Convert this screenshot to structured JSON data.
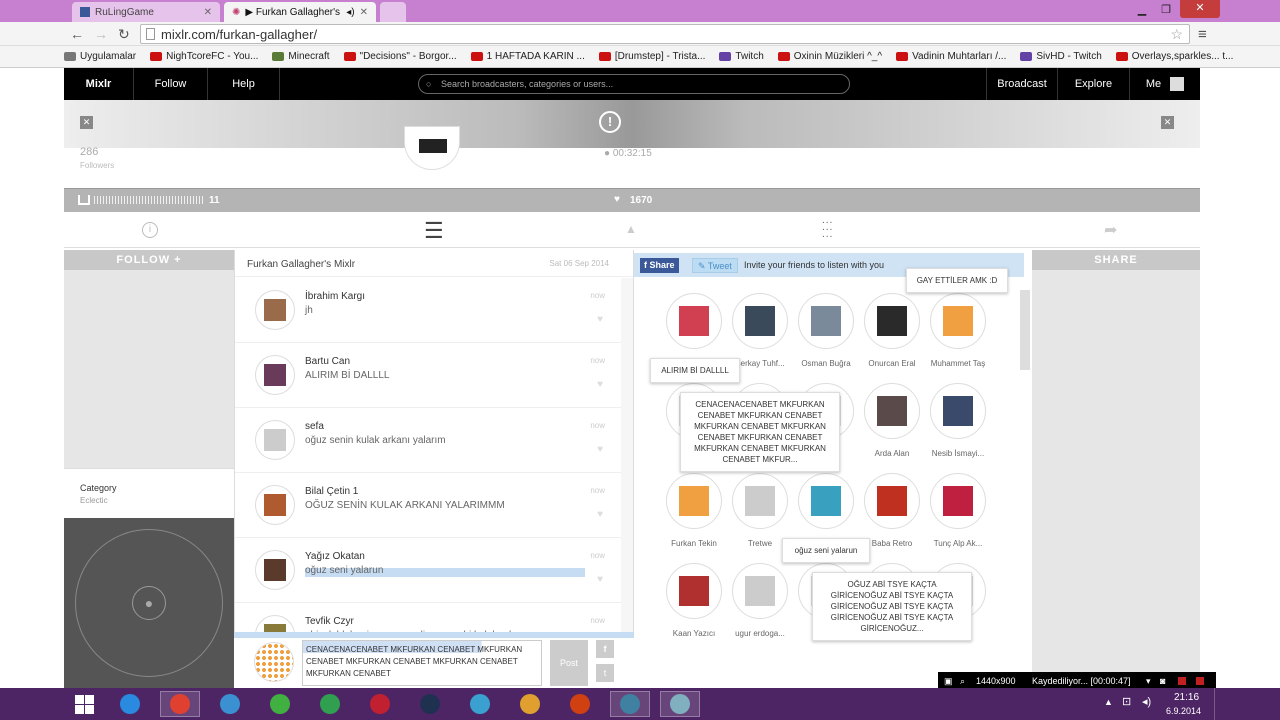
{
  "browser": {
    "tabs": [
      {
        "label": "RuLingGame"
      },
      {
        "label": "▶ Furkan Gallagher's M"
      }
    ],
    "url": "mixlr.com/furkan-gallagher/",
    "bookmarks": [
      {
        "label": "Uygulamalar",
        "color": "#777777"
      },
      {
        "label": "NighTcoreFC - You...",
        "color": "#cc1111"
      },
      {
        "label": "Minecraft",
        "color": "#5a7a3a"
      },
      {
        "label": "\"Decisions\" - Borgor...",
        "color": "#cc1111"
      },
      {
        "label": "1 HAFTADA KARIN ...",
        "color": "#cc1111"
      },
      {
        "label": "[Drumstep] - Trista...",
        "color": "#cc1111"
      },
      {
        "label": "Twitch",
        "color": "#6441a5"
      },
      {
        "label": "Oxinin Müzikleri ^_^",
        "color": "#cc1111"
      },
      {
        "label": "Vadinin Muhtarları /...",
        "color": "#cc1111"
      },
      {
        "label": "SivHD - Twitch",
        "color": "#6441a5"
      },
      {
        "label": "Overlays,sparkles... t...",
        "color": "#cc1111"
      }
    ]
  },
  "mixlr": {
    "logo": "Mixlr",
    "nav": {
      "follow": "Follow",
      "help": "Help",
      "broadcast": "Broadcast",
      "explore": "Explore",
      "me": "Me"
    },
    "search_placeholder": "Search broadcasters, categories or users...",
    "followers_count": "286",
    "followers_label": "Followers",
    "duration": "00:32:15",
    "listeners_count": "11",
    "hearts": "1670",
    "follow_side": "FOLLOW +",
    "share_side": "SHARE",
    "category_label": "Category",
    "category_value": "Eclectic"
  },
  "chat": {
    "title": "Furkan Gallagher's Mixlr",
    "date": "Sat 06 Sep 2014",
    "messages": [
      {
        "name": "İbrahim Kargı",
        "text": "jh",
        "time": "now",
        "color": "#9a6b4a"
      },
      {
        "name": "Bartu Can",
        "text": "ALIRIM Bİ DALLLL",
        "time": "now",
        "color": "#6a3a5a"
      },
      {
        "name": "sefa",
        "text": "oğuz senin kulak arkanı yalarım",
        "time": "now",
        "color": "#cccccc"
      },
      {
        "name": "Bilal Çetin 1",
        "text": "OĞUZ SENİN KULAK ARKANI YALARIMMM",
        "time": "now",
        "color": "#b05a30"
      },
      {
        "name": "Yağız Okatan",
        "text": "oğuz seni yalarun",
        "time": "now",
        "color": "#5a3a2a"
      },
      {
        "name": "Tevfik Czyr",
        "text": "abi sıkıldı beni savunsun diye ona abi kulak arkasını",
        "time": "now",
        "color": "#8a7a3a"
      }
    ],
    "input_value": "CENACENACENABET MKFURKAN CENABET MKFURKAN CENABET MKFURKAN CENABET MKFURKAN CENABET MKFURKAN CENABET",
    "post_label": "Post"
  },
  "share": {
    "facebook": "Share",
    "tweet": "Tweet",
    "invite": "Invite your friends to listen with you"
  },
  "listeners": [
    {
      "name": "",
      "color": "#d04050"
    },
    {
      "name": "Berkay Tuhf...",
      "color": "#3a4a5a"
    },
    {
      "name": "Osman Buğra",
      "color": "#7a8a9a"
    },
    {
      "name": "Onurcan Eral",
      "color": "#2a2a2a"
    },
    {
      "name": "Muhammet Taş",
      "color": "#f0a040"
    },
    {
      "name": "E",
      "color": "#dddddd"
    },
    {
      "name": "",
      "color": "#dddddd"
    },
    {
      "name": "n 1",
      "color": "#dddddd"
    },
    {
      "name": "Arda Alan",
      "color": "#5a4a4a"
    },
    {
      "name": "Nesib İsmayi...",
      "color": "#3a4a6a"
    },
    {
      "name": "Furkan Tekin",
      "color": "#f0a040"
    },
    {
      "name": "Tretwe",
      "color": "#cccccc"
    },
    {
      "name": "",
      "color": "#3aa0c0"
    },
    {
      "name": "Baba Retro",
      "color": "#c03020"
    },
    {
      "name": "Tunç Alp Ak...",
      "color": "#c02040"
    },
    {
      "name": "Kaan Yazıcı",
      "color": "#b03030"
    },
    {
      "name": "ugur erdoga...",
      "color": "#cccccc"
    },
    {
      "name": "Ya",
      "color": "#dddddd"
    },
    {
      "name": "",
      "color": "#dddddd"
    },
    {
      "name": "nat",
      "color": "#dddddd"
    }
  ],
  "bubbles": {
    "b1": "GAY ETTİLER AMK :D",
    "b2": "ALIRIM Bİ DALLLL",
    "b3": "CENACENACENABET MKFURKAN CENABET MKFURKAN CENABET MKFURKAN CENABET MKFURKAN CENABET MKFURKAN CENABET MKFURKAN CENABET MKFURKAN CENABET MKFUR...",
    "b4": "oğuz seni yalarun",
    "b5": "OĞUZ ABİ TSYE KAÇTA GİRİCENOĞUZ ABİ TSYE KAÇTA GİRİCENOĞUZ ABİ TSYE KAÇTA GİRİCENOĞUZ ABİ TSYE KAÇTA GİRİCENOĞUZ..."
  },
  "recorder": {
    "resolution": "1440x900",
    "status": "Kaydediliyor... [00:00:47]"
  },
  "taskbar": {
    "time": "21:16",
    "date": "6.9.2014",
    "apps": [
      {
        "name": "ie-icon",
        "color": "#2a8ae0"
      },
      {
        "name": "chrome-icon",
        "color": "#e04030"
      },
      {
        "name": "ccleaner-icon",
        "color": "#3a90d0"
      },
      {
        "name": "utorrent-icon",
        "color": "#40b040"
      },
      {
        "name": "green-app-icon",
        "color": "#30a050"
      },
      {
        "name": "game-icon",
        "color": "#c02030"
      },
      {
        "name": "dark-app-icon",
        "color": "#203050"
      },
      {
        "name": "globe-app-icon",
        "color": "#3aa0d0"
      },
      {
        "name": "puzzle-app-icon",
        "color": "#e0a030"
      },
      {
        "name": "illustrator-icon",
        "color": "#d04010"
      },
      {
        "name": "media-app-icon",
        "color": "#4080a0"
      },
      {
        "name": "notes-app-icon",
        "color": "#80b0c0"
      }
    ]
  }
}
